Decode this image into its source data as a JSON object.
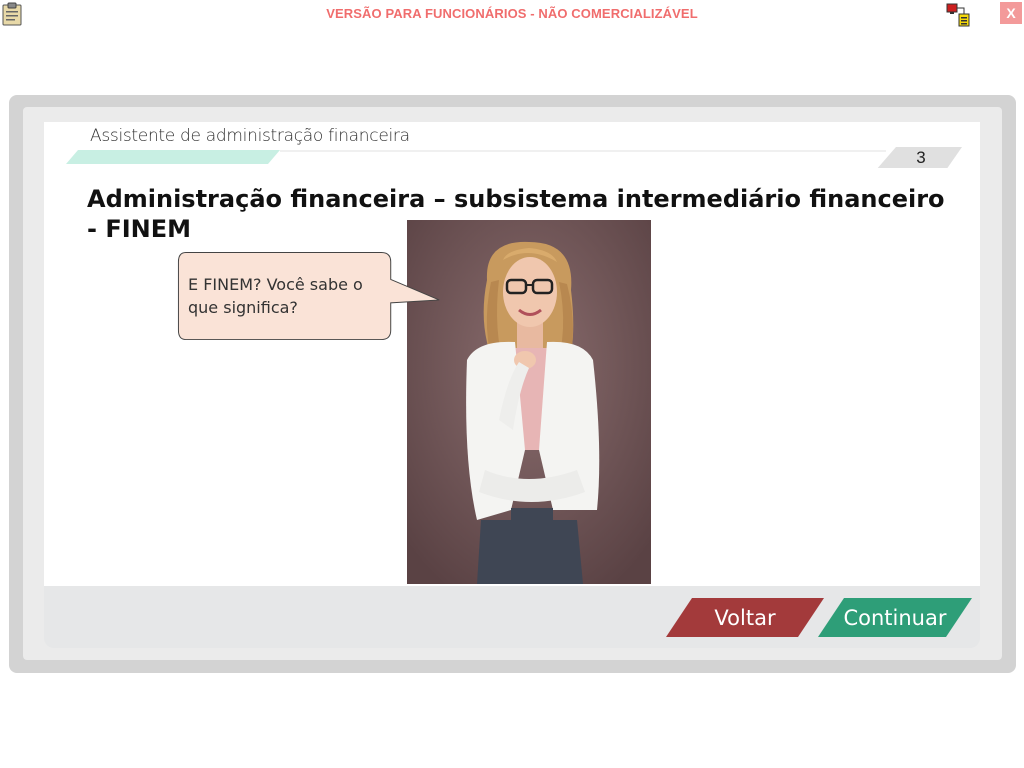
{
  "top_bar": {
    "banner_text": "VERSÃO PARA FUNCIONÁRIOS - NÃO COMERCIALIZÁVEL",
    "close_label": "X",
    "banner_color": "#f06d6d",
    "left_icon": "clipboard-icon",
    "right_icon": "network-status-icon"
  },
  "header": {
    "module_title": "Assistente de administração financeira",
    "page_number": "3",
    "accent_color": "#c8efe3"
  },
  "slide": {
    "title": "Administração financeira – subsistema intermediário financeiro - FINEM",
    "speech_text": "E FINEM? Você sabe o que significa?",
    "speech_bubble_color": "#fae3d7",
    "photo_subject": "smiling woman in white blazer with glasses"
  },
  "navigation": {
    "back_label": "Voltar",
    "next_label": "Continuar",
    "back_color": "#a33a3b",
    "next_color": "#2e9e78"
  }
}
